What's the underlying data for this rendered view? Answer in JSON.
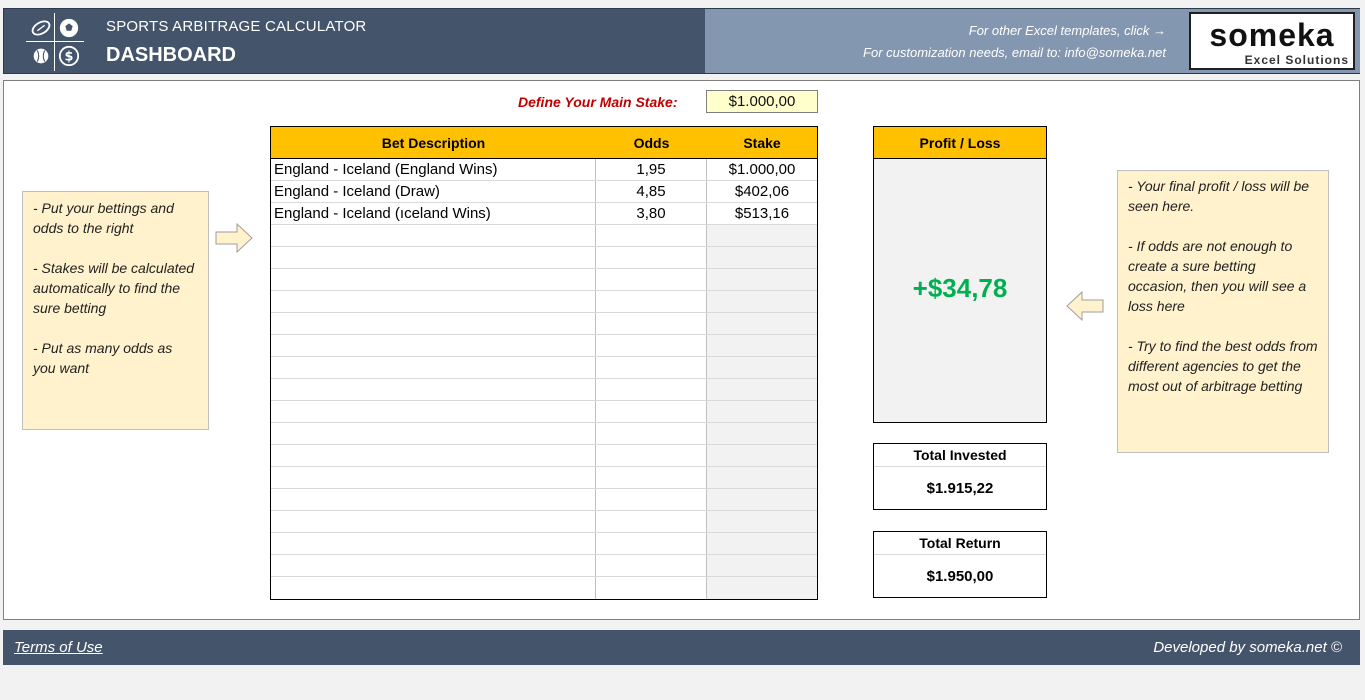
{
  "header": {
    "app_title": "SPORTS ARBITRAGE CALCULATOR",
    "page_title": "DASHBOARD",
    "templates_link": "For other Excel templates, click →",
    "customization_text": "For customization needs, email to: info@someka.net",
    "brand_name": "someka",
    "brand_sub": "Excel Solutions"
  },
  "stake": {
    "label": "Define Your Main Stake:",
    "value": "$1.000,00"
  },
  "bets_table": {
    "headers": [
      "Bet Description",
      "Odds",
      "Stake"
    ],
    "rows": [
      [
        "England - Iceland (England Wins)",
        "1,95",
        "$1.000,00"
      ],
      [
        "England - Iceland (Draw)",
        "4,85",
        "$402,06"
      ],
      [
        "England - Iceland (ıceland Wins)",
        "3,80",
        "$513,16"
      ],
      [
        "",
        "",
        ""
      ],
      [
        "",
        "",
        ""
      ],
      [
        "",
        "",
        ""
      ],
      [
        "",
        "",
        ""
      ],
      [
        "",
        "",
        ""
      ],
      [
        "",
        "",
        ""
      ],
      [
        "",
        "",
        ""
      ],
      [
        "",
        "",
        ""
      ],
      [
        "",
        "",
        ""
      ],
      [
        "",
        "",
        ""
      ],
      [
        "",
        "",
        ""
      ],
      [
        "",
        "",
        ""
      ],
      [
        "",
        "",
        ""
      ],
      [
        "",
        "",
        ""
      ],
      [
        "",
        "",
        ""
      ],
      [
        "",
        "",
        ""
      ],
      [
        "",
        "",
        ""
      ]
    ]
  },
  "notes": {
    "left": "- Put your bettings and odds to the right\n\n- Stakes will be calculated automatically to find the sure betting\n\n- Put as many odds as you want",
    "right": "- Your final profit / loss will be seen here.\n\n- If odds are not enough to create a sure betting occasion, then you will see a loss here\n\n- Try to find the best odds from different agencies to get the most out of arbitrage betting"
  },
  "profit": {
    "header": "Profit / Loss",
    "value": "+$34,78"
  },
  "total_invested": {
    "label": "Total Invested",
    "value": "$1.915,22"
  },
  "total_return": {
    "label": "Total Return",
    "value": "$1.950,00"
  },
  "footer": {
    "terms": "Terms of Use",
    "developed": "Developed by someka.net ©"
  },
  "colors": {
    "header_dark": "#44546a",
    "header_light": "#8497b0",
    "table_header": "#ffc000",
    "note_bg": "#fff2cc",
    "profit_positive": "#00b050",
    "stake_label": "#c00000"
  }
}
